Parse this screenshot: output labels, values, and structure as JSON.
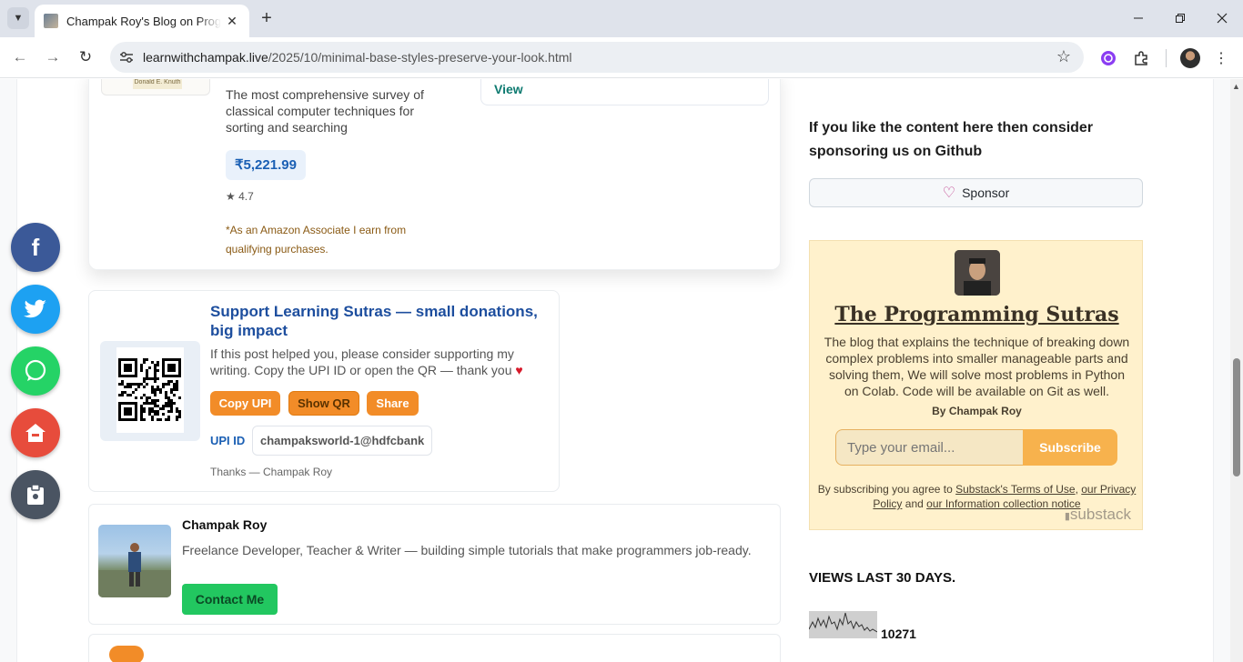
{
  "browser": {
    "tab_title": "Champak Roy's Blog on Programming",
    "url_host": "learnwithchampak.live",
    "url_path": "/2025/10/minimal-base-styles-preserve-your-look.html"
  },
  "product": {
    "image_caption": "Donald E. Knuth",
    "description": "The most comprehensive survey of classical computer techniques for sorting and searching",
    "price": "₹5,221.99",
    "rating": "★ 4.7",
    "disclaimer": "*As an Amazon Associate I earn from qualifying purchases.",
    "view_label": "View"
  },
  "support": {
    "title": "Support Learning Sutras — small donations, big impact",
    "text": "If this post helped you, please consider supporting my writing. Copy the UPI ID or open the QR — thank you",
    "heart": "♥",
    "copy_upi": "Copy UPI",
    "show_qr": "Show QR",
    "share": "Share",
    "upi_label": "UPI ID",
    "upi_id": "champaksworld-1@hdfcbank",
    "thanks": "Thanks — Champak Roy"
  },
  "author": {
    "name": "Champak Roy",
    "bio": "Freelance Developer, Teacher & Writer — building simple tutorials that make programmers job-ready.",
    "contact_label": "Contact Me"
  },
  "social": {
    "facebook": "f",
    "colors": {
      "facebook": "#3b5998",
      "twitter": "#1da1f2",
      "whatsapp": "#25d366",
      "home": "#e74c3c",
      "dark": "#4a5462"
    }
  },
  "sidebar": {
    "sponsor_heading": "If you like the content here then consider sponsoring us on Github",
    "sponsor_label": "Sponsor",
    "substack": {
      "title": "The Programming Sutras",
      "description": "The blog that explains the technique of breaking down complex problems into smaller manageable parts and solving them, We will solve most problems in Python on Colab. Code will be available on Git as well.",
      "byline": "By Champak Roy",
      "email_placeholder": "Type your email...",
      "subscribe_label": "Subscribe",
      "terms_prefix": "By subscribing you agree to ",
      "terms_link": "Substack's Terms of Use",
      "terms_sep": ", ",
      "privacy_link": "our Privacy Policy",
      "terms_and": " and ",
      "info_link": "our Information collection notice",
      "logo_text": "substack"
    },
    "views_heading": "VIEWS LAST 30 DAYS.",
    "views_count": "10271"
  }
}
